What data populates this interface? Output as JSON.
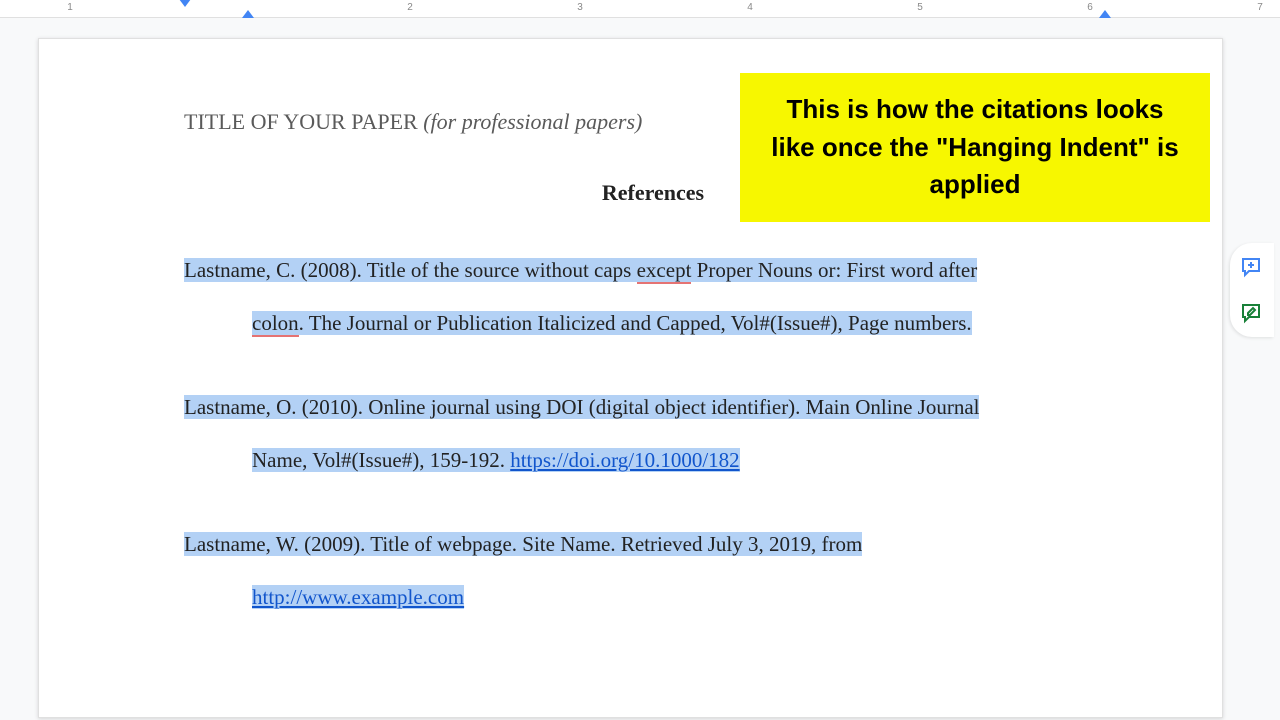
{
  "ruler": {
    "numbers": [
      "1",
      "2",
      "3",
      "4",
      "5",
      "6",
      "7"
    ]
  },
  "callout": {
    "text": "This is how the citations looks like once the \"Hanging Indent\" is applied"
  },
  "document": {
    "running_head_prefix": "TITLE OF YOUR PAPER ",
    "running_head_italic": "(for professional papers)",
    "references_heading": "References",
    "citations": [
      {
        "line1_a": "Lastname, C. (2008). Title of the source without caps ",
        "line1_err": "except",
        "line1_b": " Proper Nouns or: First word after",
        "line2_err": "colon",
        "line2_b": ". The Journal or Publication Italicized and Capped, Vol#(Issue#), Page numbers."
      },
      {
        "line1": "Lastname, O. (2010). Online journal using DOI (digital object identifier). Main Online Journal",
        "line2_a": "Name, Vol#(Issue#), 159-192. ",
        "line2_link": "https://doi.org/10.1000/182"
      },
      {
        "line1": "Lastname, W. (2009). Title of webpage. Site Name. Retrieved July 3, 2019, from",
        "line2_link": "http://www.example.com"
      }
    ]
  },
  "sidebar": {
    "add_comment_label": "Add comment",
    "suggest_label": "Suggesting"
  }
}
